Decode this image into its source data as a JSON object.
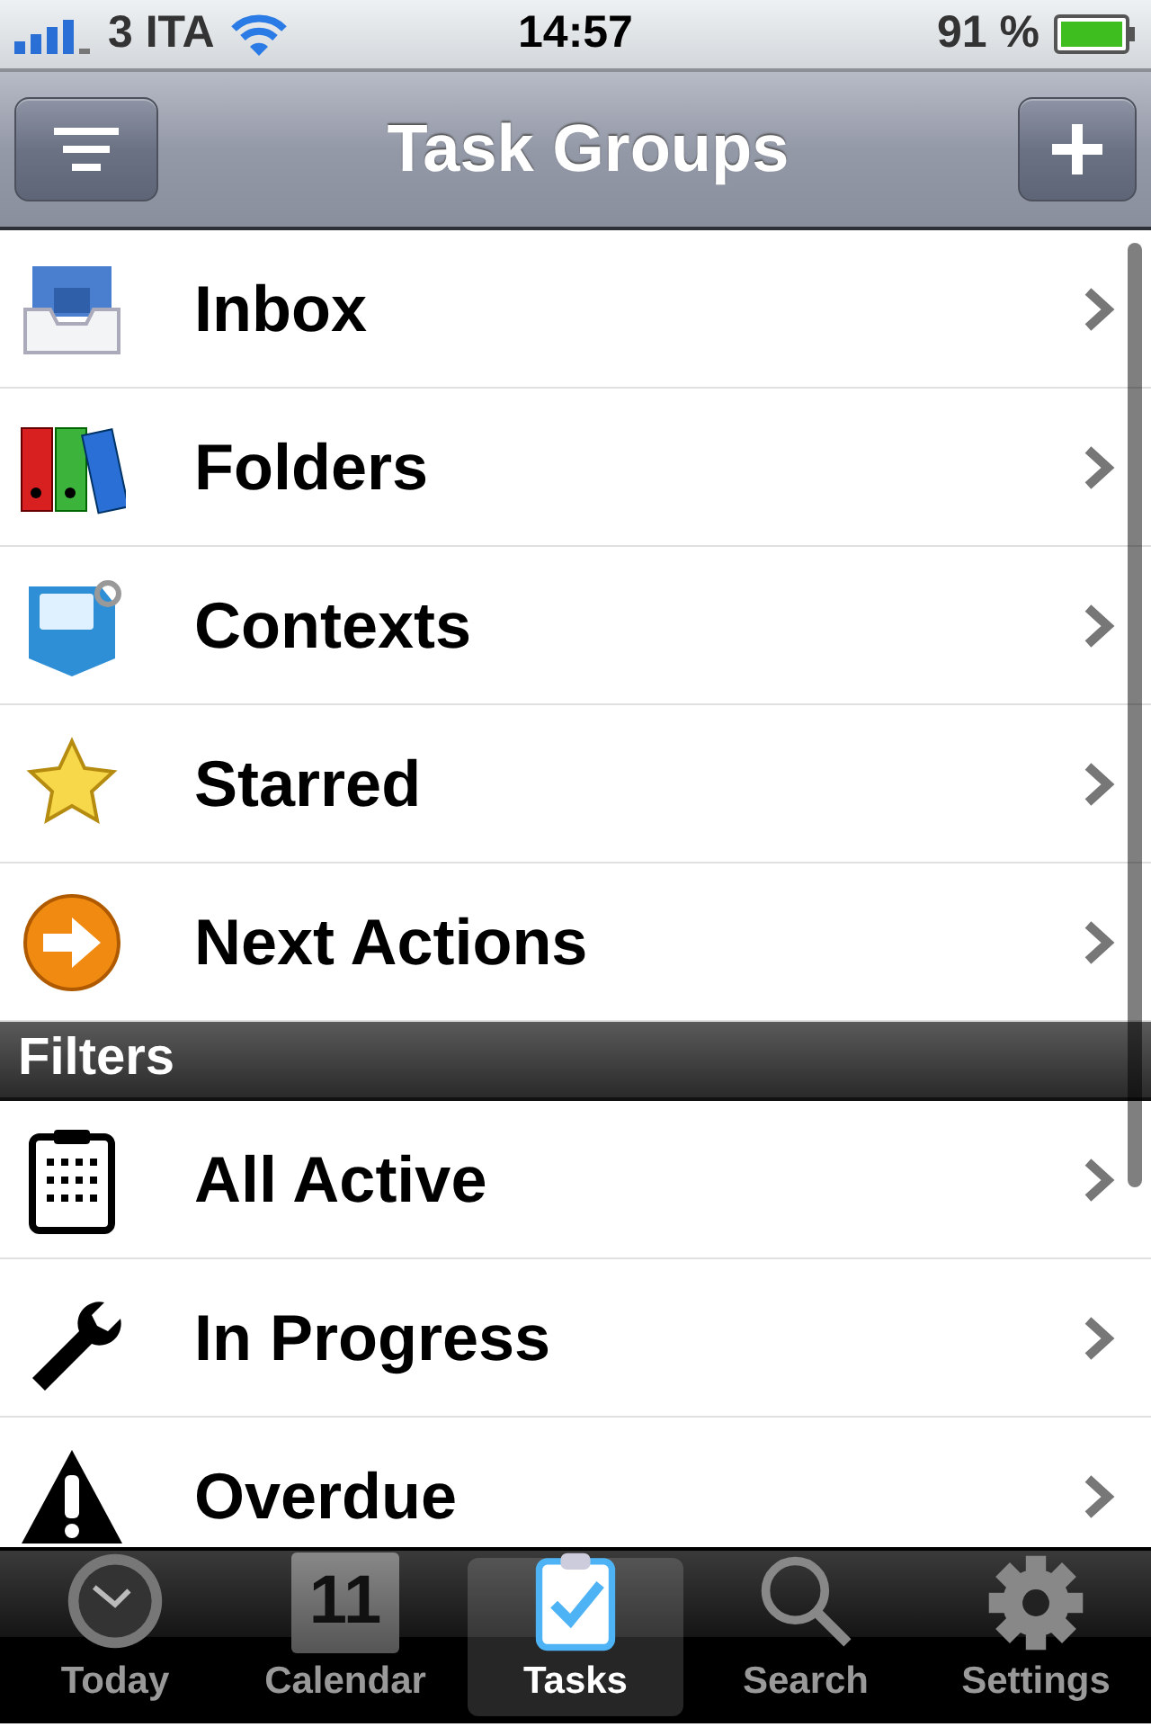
{
  "status_bar": {
    "carrier": "3 ITA",
    "time": "14:57",
    "battery": "91 %"
  },
  "nav_bar": {
    "title": "Task Groups"
  },
  "sections": [
    {
      "items": [
        {
          "label": "Inbox"
        },
        {
          "label": "Folders"
        },
        {
          "label": "Contexts"
        },
        {
          "label": "Starred"
        },
        {
          "label": "Next Actions"
        }
      ]
    },
    {
      "header": "Filters",
      "items": [
        {
          "label": "All Active"
        },
        {
          "label": "In Progress"
        },
        {
          "label": "Overdue"
        }
      ]
    }
  ],
  "tab_bar": [
    {
      "label": "Today",
      "selected": false
    },
    {
      "label": "Calendar",
      "icon_text": "11",
      "selected": false
    },
    {
      "label": "Tasks",
      "selected": true
    },
    {
      "label": "Search",
      "selected": false
    },
    {
      "label": "Settings",
      "selected": false
    }
  ]
}
